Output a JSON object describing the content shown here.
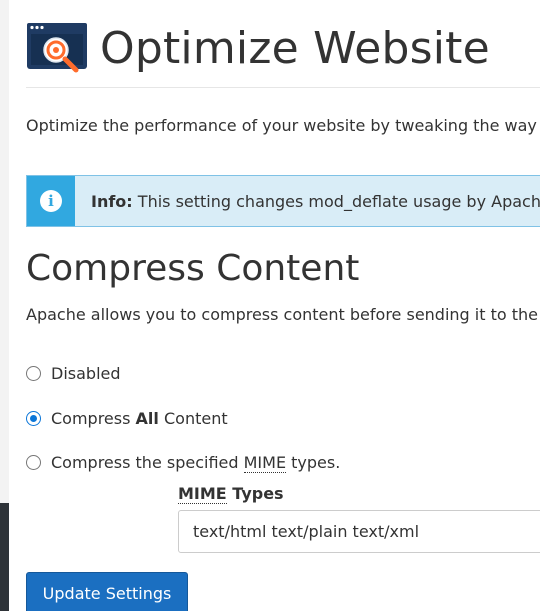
{
  "header": {
    "title": "Optimize Website",
    "icon": "optimize-website-icon"
  },
  "description": "Optimize the performance of your website by tweaking the way Apache handles requests.",
  "info": {
    "label": "Info:",
    "text": " This setting changes mod_deflate usage by Apache."
  },
  "compress": {
    "title": "Compress Content",
    "description": "Apache allows you to compress content before sending it to the visitor's browser.",
    "options": [
      {
        "label": "Disabled",
        "checked": false
      },
      {
        "label_prefix": "Compress ",
        "label_bold": "All",
        "label_suffix": " Content",
        "checked": true
      },
      {
        "label_prefix": "Compress the specified ",
        "label_abbr": "MIME",
        "label_suffix": " types.",
        "checked": false
      }
    ],
    "mime_label_abbr": "MIME",
    "mime_label_suffix": " Types",
    "mime_value": "text/html text/plain text/xml"
  },
  "actions": {
    "update_label": "Update Settings"
  },
  "colors": {
    "primary": "#1b6fc1",
    "info_bg": "#d9edf7",
    "info_icon": "#31a8e0",
    "radio_checked": "#0b76d8"
  }
}
